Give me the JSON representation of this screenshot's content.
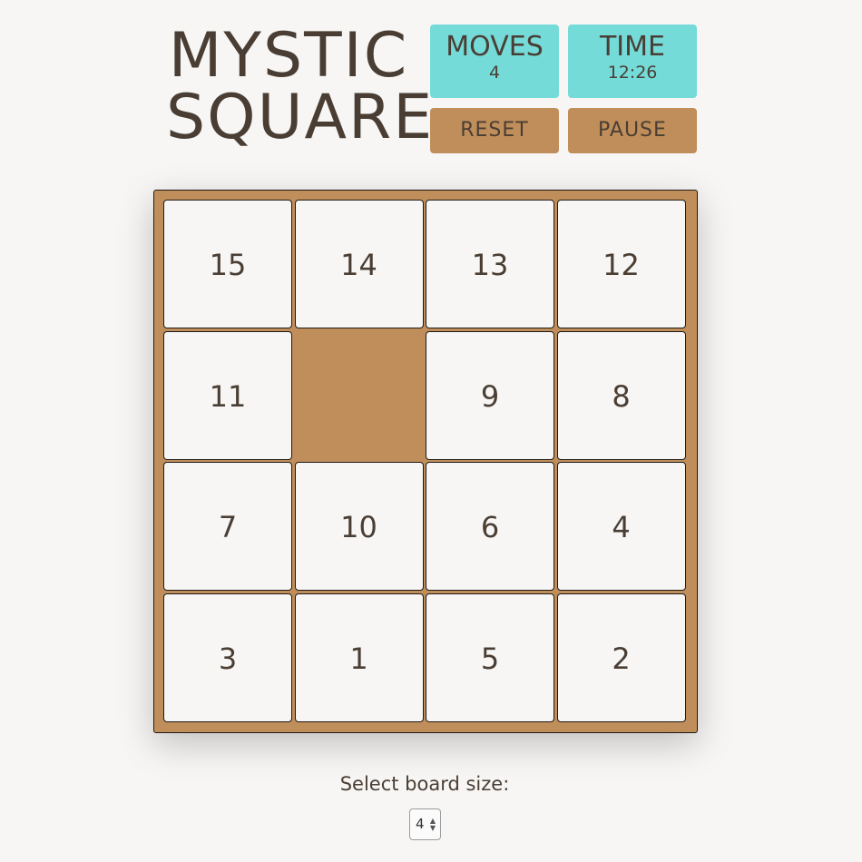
{
  "title": {
    "line1": "MYSTIC",
    "line2": "SQUARE"
  },
  "stats": {
    "moves_label": "MOVES",
    "moves_value": "4",
    "time_label": "TIME",
    "time_value": "12:26"
  },
  "buttons": {
    "reset": "RESET",
    "pause": "PAUSE"
  },
  "board": {
    "size": 4,
    "rows": [
      [
        "15",
        "14",
        "13",
        "12"
      ],
      [
        "11",
        "",
        "9",
        "8"
      ],
      [
        "7",
        "10",
        "6",
        "4"
      ],
      [
        "3",
        "1",
        "5",
        "2"
      ]
    ]
  },
  "size_selector": {
    "label": "Select board size:",
    "value": "4"
  },
  "colors": {
    "background": "#f7f6f4",
    "accent_teal": "#74dbd9",
    "accent_brown": "#c08e5a",
    "text": "#4a3e34"
  }
}
